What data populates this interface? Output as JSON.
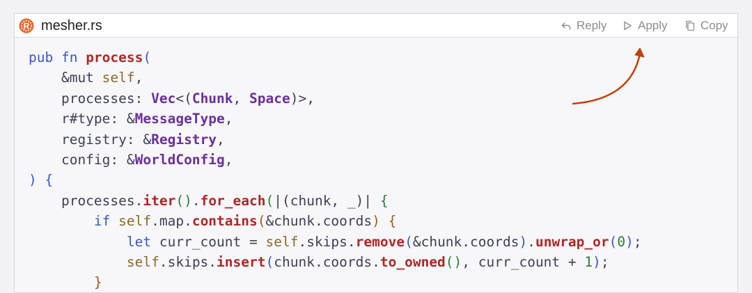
{
  "file": {
    "name": "mesher.rs",
    "language_icon": "rust-logo-icon"
  },
  "actions": {
    "reply": {
      "label": "Reply",
      "icon": "reply-icon"
    },
    "apply": {
      "label": "Apply",
      "icon": "play-icon"
    },
    "copy": {
      "label": "Copy",
      "icon": "copy-icon"
    }
  },
  "code": [
    [
      [
        "kw",
        "pub fn "
      ],
      [
        "fn",
        "process"
      ],
      [
        "br1",
        "("
      ]
    ],
    [
      [
        "",
        "    &mut "
      ],
      [
        "sf",
        "self"
      ],
      [
        "",
        ","
      ]
    ],
    [
      [
        "",
        "    processes: "
      ],
      [
        "ty",
        "Vec"
      ],
      [
        "",
        "<("
      ],
      [
        "ty",
        "Chunk"
      ],
      [
        "",
        ", "
      ],
      [
        "ty",
        "Space"
      ],
      [
        "",
        ")>,"
      ]
    ],
    [
      [
        "",
        "    r#type: &"
      ],
      [
        "ty",
        "MessageType"
      ],
      [
        "",
        ","
      ]
    ],
    [
      [
        "",
        "    registry: &"
      ],
      [
        "ty",
        "Registry"
      ],
      [
        "",
        ","
      ]
    ],
    [
      [
        "",
        "    config: &"
      ],
      [
        "ty",
        "WorldConfig"
      ],
      [
        "",
        ","
      ]
    ],
    [
      [
        "br1",
        ")"
      ],
      [
        "",
        " "
      ],
      [
        "br1",
        "{"
      ]
    ],
    [
      [
        "",
        "    processes."
      ],
      [
        "fn",
        "iter"
      ],
      [
        "br2",
        "()"
      ],
      [
        "",
        "."
      ],
      [
        "fn",
        "for_each"
      ],
      [
        "br2",
        "("
      ],
      [
        "",
        "|(chunk, _)| "
      ],
      [
        "br2",
        "{"
      ]
    ],
    [
      [
        "",
        "        "
      ],
      [
        "kw",
        "if "
      ],
      [
        "sf",
        "self"
      ],
      [
        "",
        ".map."
      ],
      [
        "fn",
        "contains"
      ],
      [
        "br3",
        "("
      ],
      [
        "",
        "&chunk.coords"
      ],
      [
        "br3",
        ")"
      ],
      [
        "",
        " "
      ],
      [
        "br3",
        "{"
      ]
    ],
    [
      [
        "",
        "            "
      ],
      [
        "kw",
        "let "
      ],
      [
        "",
        "curr_count = "
      ],
      [
        "sf",
        "self"
      ],
      [
        "",
        ".skips."
      ],
      [
        "fn",
        "remove"
      ],
      [
        "br1",
        "("
      ],
      [
        "",
        "&chunk.coords"
      ],
      [
        "br1",
        ")"
      ],
      [
        "",
        "."
      ],
      [
        "fn",
        "unwrap_or"
      ],
      [
        "br1",
        "("
      ],
      [
        "num",
        "0"
      ],
      [
        "br1",
        ")"
      ],
      [
        "",
        ";"
      ]
    ],
    [
      [
        "",
        "            "
      ],
      [
        "sf",
        "self"
      ],
      [
        "",
        ".skips."
      ],
      [
        "fn",
        "insert"
      ],
      [
        "br1",
        "("
      ],
      [
        "",
        "chunk.coords."
      ],
      [
        "fn",
        "to_owned"
      ],
      [
        "br2",
        "()"
      ],
      [
        "",
        ", curr_count + "
      ],
      [
        "num",
        "1"
      ],
      [
        "br1",
        ")"
      ],
      [
        "",
        ";"
      ]
    ],
    [
      [
        "",
        "        "
      ],
      [
        "br3",
        "}"
      ]
    ]
  ],
  "colors": {
    "keyword": "#3c56c6",
    "function": "#b02626",
    "type": "#6b2f9a",
    "arrow": "#c2410c"
  }
}
